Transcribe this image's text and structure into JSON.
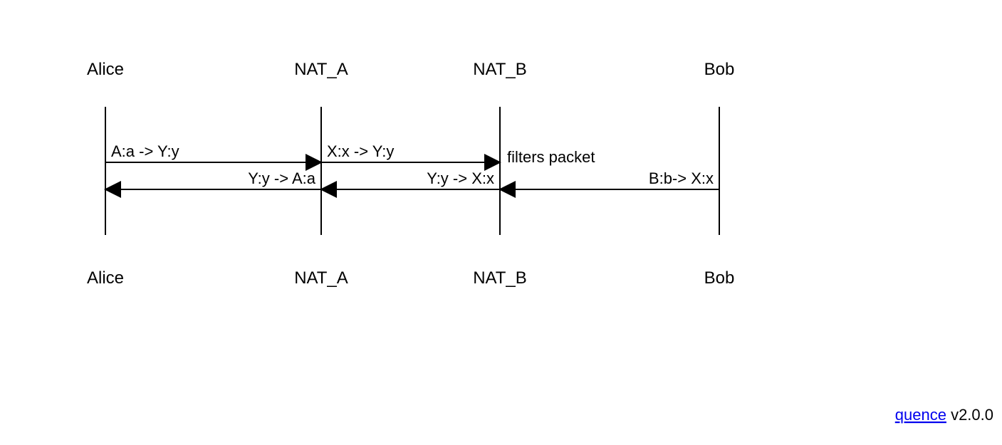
{
  "chart_data": {
    "type": "sequence",
    "participants": [
      "Alice",
      "NAT_A",
      "NAT_B",
      "Bob"
    ],
    "messages": [
      {
        "from": "Alice",
        "to": "NAT_A",
        "label": "A:a -> Y:y",
        "row": 1,
        "align": "left"
      },
      {
        "from": "NAT_A",
        "to": "NAT_B",
        "label": "X:x -> Y:y",
        "row": 1,
        "align": "left"
      },
      {
        "from": "NAT_B",
        "to": "NAT_B",
        "label": "filters packet",
        "row": 1,
        "align": "right-note"
      },
      {
        "from": "Bob",
        "to": "NAT_B",
        "label": "B:b-> X:x",
        "row": 2,
        "align": "right"
      },
      {
        "from": "NAT_B",
        "to": "NAT_A",
        "label": "Y:y -> X:x",
        "row": 2,
        "align": "right"
      },
      {
        "from": "NAT_A",
        "to": "Alice",
        "label": "Y:y -> A:a",
        "row": 2,
        "align": "right"
      }
    ]
  },
  "participants": {
    "p0": "Alice",
    "p1": "NAT_A",
    "p2": "NAT_B",
    "p3": "Bob"
  },
  "labels": {
    "m0": "A:a -> Y:y",
    "m1": "X:x -> Y:y",
    "m2": "filters packet",
    "m3": "Y:y -> A:a",
    "m4": "Y:y -> X:x",
    "m5": "B:b-> X:x"
  },
  "credits": {
    "link_text": "quence",
    "version": " v2.0.0"
  }
}
